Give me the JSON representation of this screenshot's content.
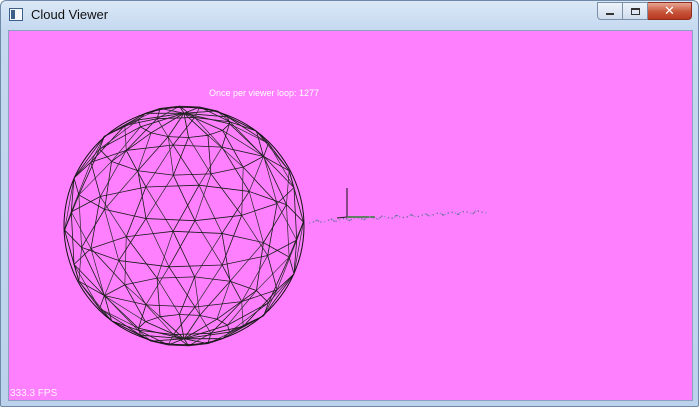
{
  "window": {
    "title": "Cloud Viewer",
    "controls": {
      "minimize": "minimize",
      "maximize": "maximize",
      "close": "close"
    }
  },
  "viewer": {
    "background_color": "#ff80ff",
    "overlay_text": "Once per viewer loop: 1277",
    "fps_text": "333.3 FPS",
    "objects": [
      "wireframe-sphere",
      "coordinate-axes",
      "point-cloud-line"
    ]
  }
}
